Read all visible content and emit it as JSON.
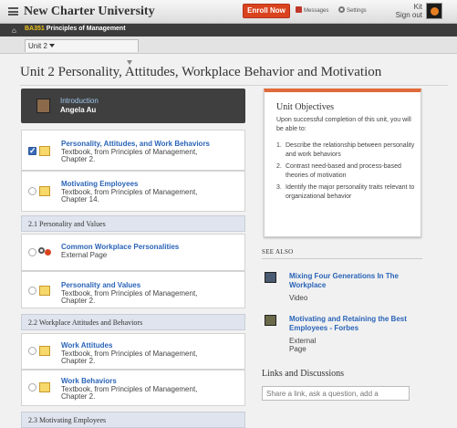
{
  "app": {
    "brand": "New Charter University"
  },
  "topbar": {
    "enroll_label": "Enroll Now",
    "messages_label": "Messages",
    "settings_label": "Settings",
    "user_name": "Kit",
    "signout_label": "Sign out"
  },
  "breadcrumb": {
    "course_code": "BA351",
    "course_name": "Principles of Management"
  },
  "unit_selector": {
    "value": "Unit 2"
  },
  "page": {
    "title": "Unit 2 Personality, Attitudes, Workplace Behavior and Motivation"
  },
  "intro": {
    "title": "Introduction",
    "author": "Angela Au"
  },
  "items": [
    {
      "title": "Personality, Attitudes, and Work Behaviors",
      "desc1": "Textbook, from Principles of Management,",
      "desc2": "Chapter 2.",
      "checked": true,
      "icon": "book-icon"
    },
    {
      "title": "Motivating Employees",
      "desc1": "Textbook, from Principles of Management,",
      "desc2": "Chapter 14.",
      "checked": false,
      "icon": "book-icon"
    },
    {
      "title": "Common Workplace Personalities",
      "desc1": "External Page",
      "desc2": "",
      "checked": false,
      "icon": "external-link-icon"
    },
    {
      "title": "Personality and Values",
      "desc1": "Textbook, from Principles of Management,",
      "desc2": "Chapter 2.",
      "checked": false,
      "icon": "book-icon"
    },
    {
      "title": "Work Attitudes",
      "desc1": "Textbook, from Principles of Management,",
      "desc2": "Chapter 2.",
      "checked": false,
      "icon": "book-icon"
    },
    {
      "title": "Work Behaviors",
      "desc1": "Textbook, from Principles of Management,",
      "desc2": "Chapter 2.",
      "checked": false,
      "icon": "book-icon"
    }
  ],
  "sections": [
    "2.1 Personality and Values",
    "2.2 Workplace Attitudes and Behaviors",
    "2.3 Motivating Employees"
  ],
  "objectives": {
    "heading": "Unit Objectives",
    "intro": "Upon successful completion of this unit, you will be able to:",
    "list": [
      "Describe the relationship between personality and work behaviors",
      "Contrast need-based and process-based theories of motivation",
      "Identify the major personality traits relevant to organizational behavior"
    ]
  },
  "see_also": {
    "heading": "SEE ALSO",
    "items": [
      {
        "title": "Mixing Four Generations In The Workplace",
        "type": "Video"
      },
      {
        "title": "Motivating and Retaining the Best Employees - Forbes",
        "type": "External Page"
      }
    ]
  },
  "links": {
    "heading": "Links and Discussions",
    "placeholder": "Share a link, ask a question, add a"
  },
  "colors": {
    "accent": "#d9441f",
    "link": "#2a64b8",
    "dark_bar": "#3c3c3c",
    "section_bg": "#dfe4ee"
  }
}
